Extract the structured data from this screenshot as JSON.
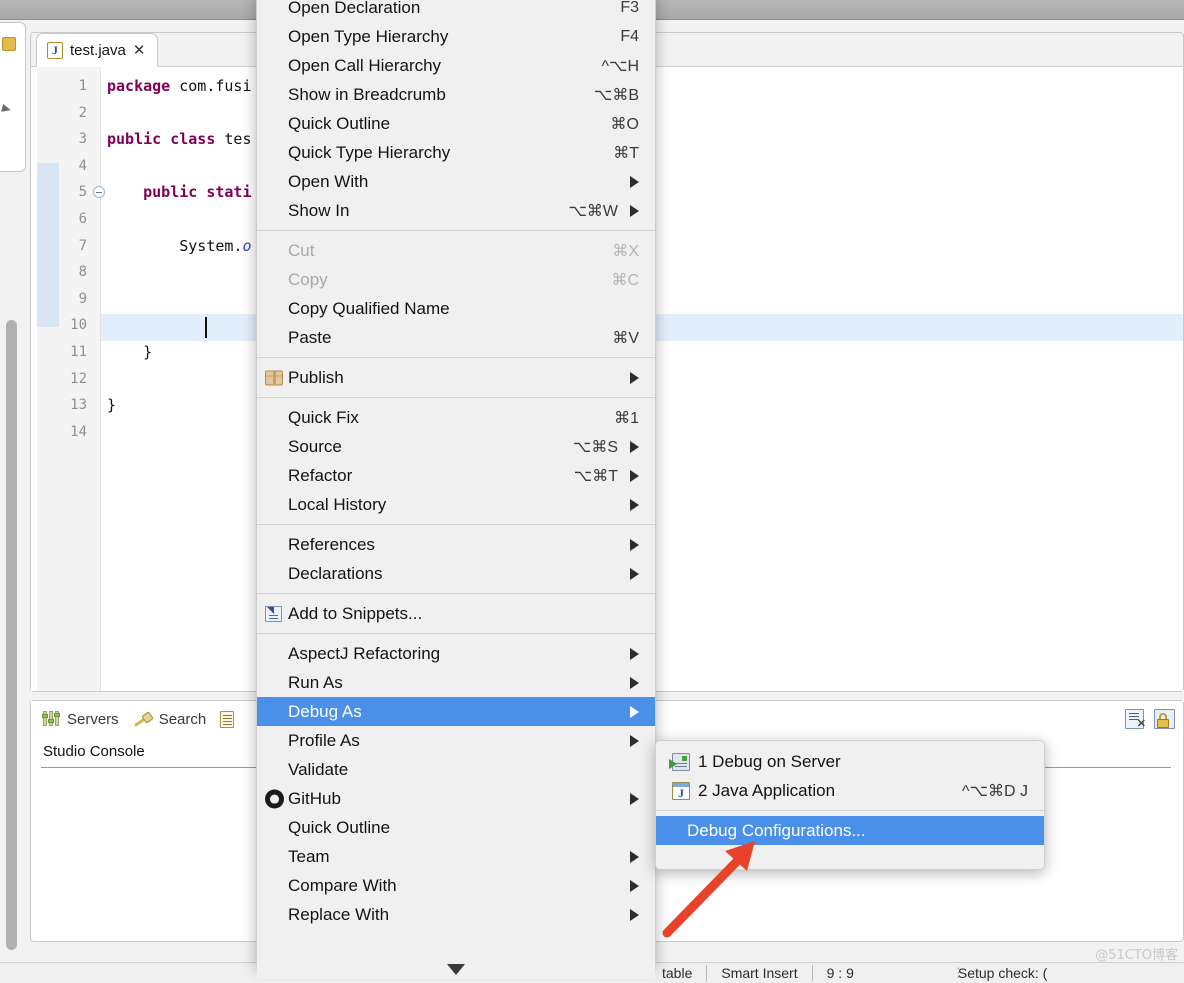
{
  "window": {
    "title": ""
  },
  "editor": {
    "tab": {
      "label": "test.java",
      "close": "✕",
      "icon": "java-file-icon",
      "letter": "J"
    },
    "lines": [
      {
        "no": "1",
        "text": "package com.fusi"
      },
      {
        "no": "2",
        "text": ""
      },
      {
        "no": "3",
        "text": "public class tes"
      },
      {
        "no": "4",
        "text": ""
      },
      {
        "no": "5",
        "text": "    public stati"
      },
      {
        "no": "6",
        "text": ""
      },
      {
        "no": "7",
        "text": "        System.o"
      },
      {
        "no": "8",
        "text": ""
      },
      {
        "no": "9",
        "text": ""
      },
      {
        "no": "10",
        "text": ""
      },
      {
        "no": "11",
        "text": "    }"
      },
      {
        "no": "12",
        "text": ""
      },
      {
        "no": "13",
        "text": "}"
      },
      {
        "no": "14",
        "text": ""
      }
    ]
  },
  "console": {
    "tabs": [
      {
        "label": "Servers",
        "icon": "servers-icon"
      },
      {
        "label": "Search",
        "icon": "search-icon"
      },
      {
        "label": "",
        "icon": "document-icon"
      }
    ],
    "title": "Studio Console",
    "toolbar": [
      {
        "icon": "clear-console-icon"
      },
      {
        "icon": "lock-scroll-icon"
      }
    ]
  },
  "statusbar": {
    "writable": "table",
    "insert_mode": "Smart Insert",
    "position": "9 : 9",
    "setup": "Setup check: ("
  },
  "context_menu": {
    "groups": [
      {
        "items": [
          {
            "label": "Open Declaration",
            "accel": "F3",
            "submenu": false,
            "disabled": false
          },
          {
            "label": "Open Type Hierarchy",
            "accel": "F4",
            "submenu": false,
            "disabled": false
          },
          {
            "label": "Open Call Hierarchy",
            "accel": "^⌥H",
            "submenu": false,
            "disabled": false
          },
          {
            "label": "Show in Breadcrumb",
            "accel": "⌥⌘B",
            "submenu": false,
            "disabled": false
          },
          {
            "label": "Quick Outline",
            "accel": "⌘O",
            "submenu": false,
            "disabled": false
          },
          {
            "label": "Quick Type Hierarchy",
            "accel": "⌘T",
            "submenu": false,
            "disabled": false
          },
          {
            "label": "Open With",
            "accel": "",
            "submenu": true,
            "disabled": false
          },
          {
            "label": "Show In",
            "accel": "⌥⌘W",
            "submenu": true,
            "disabled": false
          }
        ]
      },
      {
        "items": [
          {
            "label": "Cut",
            "accel": "⌘X",
            "submenu": false,
            "disabled": true
          },
          {
            "label": "Copy",
            "accel": "⌘C",
            "submenu": false,
            "disabled": true
          },
          {
            "label": "Copy Qualified Name",
            "accel": "",
            "submenu": false,
            "disabled": false
          },
          {
            "label": "Paste",
            "accel": "⌘V",
            "submenu": false,
            "disabled": false
          }
        ]
      },
      {
        "items": [
          {
            "label": "Publish",
            "accel": "",
            "submenu": true,
            "disabled": false,
            "icon": "publish-box-icon"
          }
        ]
      },
      {
        "items": [
          {
            "label": "Quick Fix",
            "accel": "⌘1",
            "submenu": false,
            "disabled": false
          },
          {
            "label": "Source",
            "accel": "⌥⌘S",
            "submenu": true,
            "disabled": false
          },
          {
            "label": "Refactor",
            "accel": "⌥⌘T",
            "submenu": true,
            "disabled": false
          },
          {
            "label": "Local History",
            "accel": "",
            "submenu": true,
            "disabled": false
          }
        ]
      },
      {
        "items": [
          {
            "label": "References",
            "accel": "",
            "submenu": true,
            "disabled": false
          },
          {
            "label": "Declarations",
            "accel": "",
            "submenu": true,
            "disabled": false
          }
        ]
      },
      {
        "items": [
          {
            "label": "Add to Snippets...",
            "accel": "",
            "submenu": false,
            "disabled": false,
            "icon": "snippet-icon"
          }
        ]
      },
      {
        "items": [
          {
            "label": "AspectJ Refactoring",
            "accel": "",
            "submenu": true,
            "disabled": false
          },
          {
            "label": "Run As",
            "accel": "",
            "submenu": true,
            "disabled": false
          },
          {
            "label": "Debug As",
            "accel": "",
            "submenu": true,
            "disabled": false,
            "selected": true
          },
          {
            "label": "Profile As",
            "accel": "",
            "submenu": true,
            "disabled": false
          },
          {
            "label": "Validate",
            "accel": "",
            "submenu": false,
            "disabled": false
          },
          {
            "label": "GitHub",
            "accel": "",
            "submenu": true,
            "disabled": false,
            "icon": "github-icon"
          },
          {
            "label": "Quick Outline",
            "accel": "",
            "submenu": false,
            "disabled": false
          },
          {
            "label": "Team",
            "accel": "",
            "submenu": true,
            "disabled": false
          },
          {
            "label": "Compare With",
            "accel": "",
            "submenu": true,
            "disabled": false
          },
          {
            "label": "Replace With",
            "accel": "",
            "submenu": true,
            "disabled": false
          }
        ]
      }
    ],
    "scroll_down_icon": "chevron-down-icon"
  },
  "submenu": {
    "items": [
      {
        "label": "1 Debug on Server",
        "accel": "",
        "icon": "debug-server-icon",
        "selected": false
      },
      {
        "label": "2 Java Application",
        "accel": "^⌥⌘D J",
        "icon": "java-app-icon",
        "selected": false
      }
    ],
    "footer": {
      "label": "Debug Configurations...",
      "selected": true
    }
  },
  "annotation": {
    "arrow_color": "#e8432a"
  },
  "watermark": "@51CTO博客",
  "colors": {
    "highlight": "#4a90e8",
    "menu_bg": "#f0f0f0",
    "keyword": "#7f0055"
  }
}
